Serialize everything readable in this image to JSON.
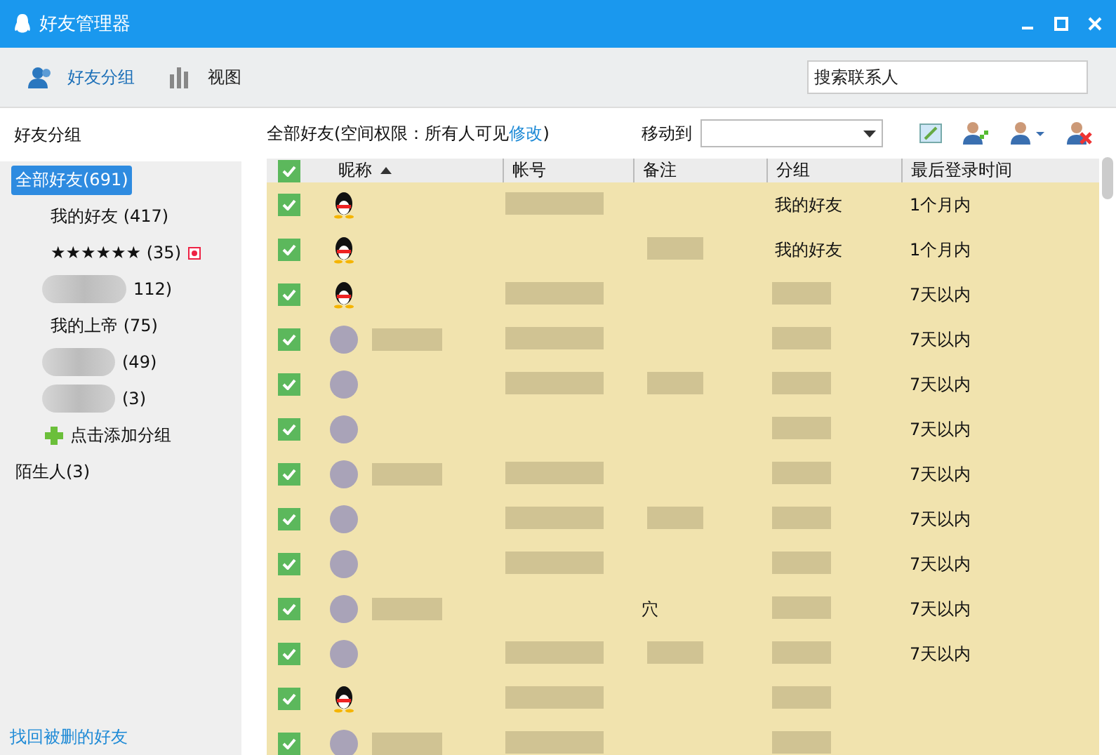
{
  "window": {
    "title": "好友管理器"
  },
  "toolbar": {
    "tabs": [
      {
        "label": "好友分组",
        "selected": true
      },
      {
        "label": "视图",
        "selected": false
      }
    ],
    "search": {
      "placeholder": "搜索联系人"
    }
  },
  "sidebar": {
    "heading": "好友分组",
    "groups": [
      {
        "label": "全部好友(691)",
        "selected": true,
        "children": [
          {
            "kind": "plain",
            "label": "我的好友 (417)",
            "selected": false,
            "badge": false
          },
          {
            "kind": "plain",
            "label": "★★★★★★ (35)",
            "selected": false,
            "badge": true
          },
          {
            "kind": "blurred",
            "label": "112)",
            "selected": false,
            "badge": false
          },
          {
            "kind": "plain",
            "label": "我的上帝 (75)",
            "selected": false,
            "badge": false
          },
          {
            "kind": "blurred",
            "label": "(49)",
            "selected": false,
            "badge": false
          },
          {
            "kind": "blurred",
            "label": "(3)",
            "selected": false,
            "badge": false
          }
        ]
      },
      {
        "label": "陌生人(3)",
        "selected": false
      }
    ],
    "add_group": "点击添加分组",
    "footer_link": "找回被删的好友"
  },
  "main": {
    "info": "全部好友(空间权限：所有人可见",
    "info_link": "修改",
    "info_end": ")",
    "move_to": {
      "label": "移动到"
    },
    "table": {
      "all_checked": true,
      "columns": [
        {
          "label": "昵称",
          "sorted": true
        },
        {
          "label": "帐号",
          "sorted": false
        },
        {
          "label": "备注",
          "sorted": false
        },
        {
          "label": "分组",
          "sorted": false
        },
        {
          "label": "最后登录时间",
          "sorted": false
        }
      ],
      "rows": [
        {
          "kind": "penguin",
          "checked": true,
          "group": "我的好友",
          "last_login": "1个月内"
        },
        {
          "kind": "penguin",
          "checked": true,
          "group": "我的好友",
          "last_login": "1个月内"
        },
        {
          "kind": "penguin",
          "checked": true,
          "last_login": "7天以内"
        },
        {
          "kind": "photo",
          "checked": true,
          "last_login": "7天以内"
        },
        {
          "kind": "photo",
          "checked": true,
          "last_login": "7天以内"
        },
        {
          "kind": "photo",
          "checked": true,
          "last_login": "7天以内"
        },
        {
          "kind": "photo",
          "checked": true,
          "last_login": "7天以内"
        },
        {
          "kind": "photo",
          "checked": true,
          "last_login": "7天以内"
        },
        {
          "kind": "photo",
          "checked": true,
          "last_login": "7天以内"
        },
        {
          "kind": "photo",
          "checked": true,
          "note": "穴",
          "last_login": "7天以内"
        },
        {
          "kind": "photo",
          "checked": true,
          "last_login": "7天以内"
        },
        {
          "kind": "penguin",
          "checked": true
        },
        {
          "kind": "photo",
          "checked": true
        }
      ]
    }
  }
}
